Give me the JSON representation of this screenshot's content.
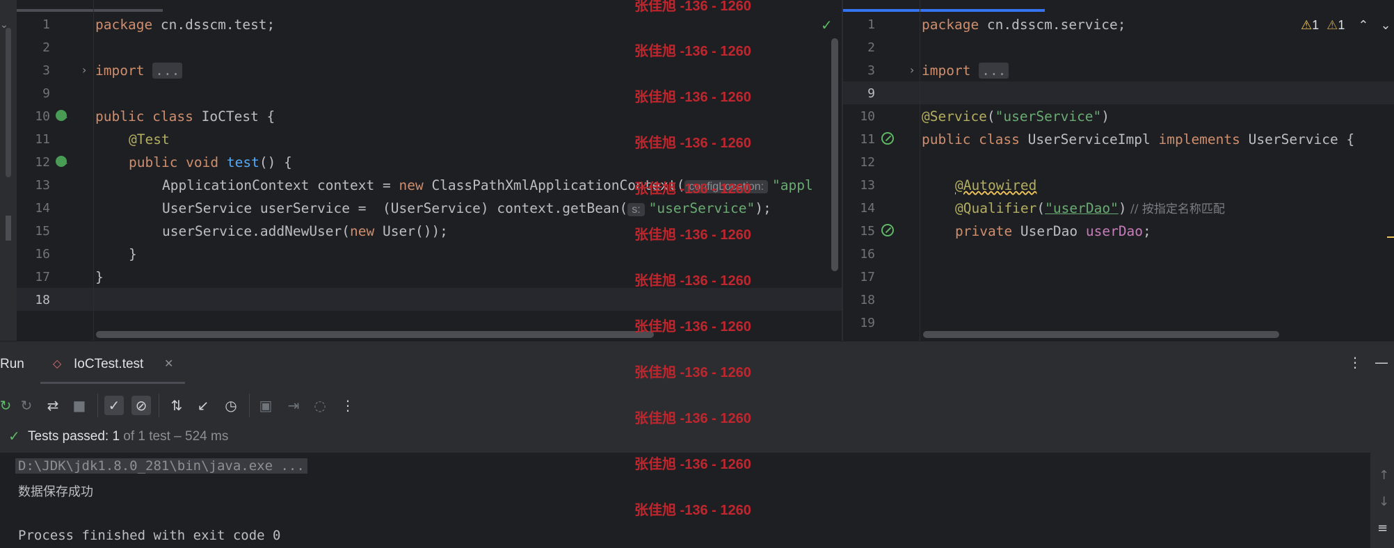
{
  "left_editor": {
    "lines": [
      {
        "num": "1",
        "current": false
      },
      {
        "num": "2",
        "current": false
      },
      {
        "num": "3",
        "current": false
      },
      {
        "num": "9",
        "current": false
      },
      {
        "num": "10",
        "current": false
      },
      {
        "num": "11",
        "current": false
      },
      {
        "num": "12",
        "current": false
      },
      {
        "num": "13",
        "current": false
      },
      {
        "num": "14",
        "current": false
      },
      {
        "num": "15",
        "current": false
      },
      {
        "num": "16",
        "current": false
      },
      {
        "num": "17",
        "current": false
      },
      {
        "num": "18",
        "current": true
      }
    ],
    "code": {
      "l1_kw": "package",
      "l1_rest": " cn.dsscm.test;",
      "l3_kw": "import",
      "l3_fold": "...",
      "l10_kw": "public class",
      "l10_rest": " IoCTest {",
      "l11_ann": "@Test",
      "l12_kw": "public void",
      "l12_fn": "test",
      "l12_rest": "() {",
      "l13_a": "ApplicationContext context = ",
      "l13_kw": "new",
      "l13_b": " ClassPathXmlApplicationContext(",
      "l13_hint": "configLocation:",
      "l13_str": "\"appl",
      "l14_a": "UserService userService =  (UserService) context.getBean(",
      "l14_hint": "s:",
      "l14_str": "\"userService\"",
      "l14_end": ");",
      "l15_a": "userService.addNewUser(",
      "l15_kw": "new",
      "l15_b": " User());",
      "l16": "}",
      "l17": "}"
    }
  },
  "right_editor": {
    "lines": [
      {
        "num": "1",
        "current": false
      },
      {
        "num": "2",
        "current": false
      },
      {
        "num": "3",
        "current": false
      },
      {
        "num": "9",
        "current": true
      },
      {
        "num": "10",
        "current": false
      },
      {
        "num": "11",
        "current": false
      },
      {
        "num": "12",
        "current": false
      },
      {
        "num": "13",
        "current": false
      },
      {
        "num": "14",
        "current": false
      },
      {
        "num": "15",
        "current": false
      },
      {
        "num": "16",
        "current": false
      },
      {
        "num": "17",
        "current": false
      },
      {
        "num": "18",
        "current": false
      },
      {
        "num": "19",
        "current": false
      }
    ],
    "code": {
      "l1_kw": "package",
      "l1_rest": " cn.dsscm.service;",
      "l3_kw": "import",
      "l3_fold": "...",
      "l10_ann": "@Service",
      "l10_p1": "(",
      "l10_str": "\"userService\"",
      "l10_p2": ")",
      "l11_kw": "public class",
      "l11_a": " UserServiceImpl ",
      "l11_kw2": "implements",
      "l11_b": " UserService {",
      "l13_ann": "@Autowired",
      "l14_ann": "@Qualifier",
      "l14_p1": "(",
      "l14_str": "\"userDao\"",
      "l14_p2": ")",
      "l14_cmt": " // 按指定名称匹配",
      "l15_kw": "private",
      "l15_a": " UserDao ",
      "l15_field": "userDao",
      "l15_end": ";"
    },
    "inspections": {
      "warnings": "1",
      "weak_warnings": "1"
    }
  },
  "watermark": "张佳旭 -136 - 1260",
  "run_panel": {
    "title": "Run",
    "tab_label": "IoCTest.test",
    "status": {
      "prefix": "Tests passed: ",
      "count": "1",
      "suffix": " of 1 test – 524 ms"
    },
    "console": {
      "line1": "D:\\JDK\\jdk1.8.0_281\\bin\\java.exe ...",
      "line2": "数据保存成功",
      "line3": "",
      "line4": "Process finished with exit code 0"
    }
  },
  "colors": {
    "accent_blue": "#3574f0",
    "success_green": "#5fb865",
    "watermark_red": "#c0262e",
    "warning_yellow": "#f2c55c"
  }
}
